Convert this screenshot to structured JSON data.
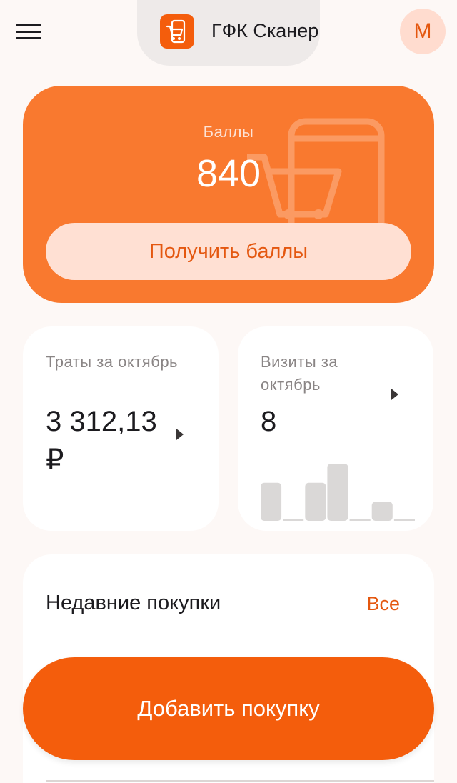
{
  "header": {
    "menu_icon": "hamburger-menu-icon",
    "app_icon": "shopping-cart-phone-icon",
    "app_title": "ГФК Сканер",
    "avatar_letter": "М"
  },
  "points_card": {
    "label": "Баллы",
    "value": "840",
    "button_label": "Получить баллы",
    "watermark_icon": "shopping-cart-phone-icon"
  },
  "spend_card": {
    "label": "Траты за октябрь",
    "value": "3 312,13 ₽",
    "chevron_icon": "chevron-right-icon"
  },
  "visits_card": {
    "label": "Визиты за октябрь",
    "value": "8",
    "chevron_icon": "chevron-right-icon",
    "bar_values": [
      2,
      0,
      2,
      3,
      0,
      1,
      0
    ]
  },
  "recent": {
    "title": "Недавние покупки",
    "all_label": "Все"
  },
  "add_purchase": {
    "label": "Добавить покупку"
  },
  "colors": {
    "accent": "#f45d0c",
    "points_card": "#f9792f",
    "accent_soft": "#ffe0d3",
    "background": "#fdf8f6"
  }
}
